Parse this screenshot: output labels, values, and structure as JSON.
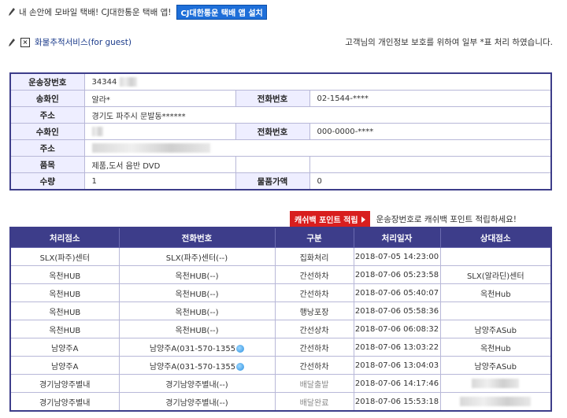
{
  "top": {
    "message": "내 손안에 모바일 택배! CJ대한통운 택배 앱!",
    "app_button": "CJ대한통운 택배 앱 설치"
  },
  "guest": {
    "title": "화물추적서비스(for guest)",
    "privacy_notice": "고객님의 개인정보 보호를 위하여 일부 *표 처리 하였습니다."
  },
  "info": {
    "waybill_label": "운송장번호",
    "waybill_value": "34344",
    "sender_label": "송화인",
    "sender_value": "알라*",
    "sender_phone_label": "전화번호",
    "sender_phone_value": "02-1544-****",
    "sender_addr_label": "주소",
    "sender_addr_value": "경기도 파주시 문발동******",
    "receiver_label": "수화인",
    "receiver_phone_label": "전화번호",
    "receiver_phone_value": "000-0000-****",
    "receiver_addr_label": "주소",
    "item_label": "품목",
    "item_value": "제품,도서 음반 DVD",
    "qty_label": "수량",
    "qty_value": "1",
    "price_label": "물품가액",
    "price_value": "0"
  },
  "cashback": {
    "button": "캐쉬백 포인트 적립",
    "text": "운송장번호로 캐쉬백 포인트 적립하세요!"
  },
  "tracking": {
    "headers": [
      "처리점소",
      "전화번호",
      "구분",
      "처리일자",
      "상대점소"
    ],
    "rows": [
      {
        "office": "SLX(파주)센터",
        "phone": "SLX(파주)센터(--)",
        "status": "집화처리",
        "date": "2018-07-05 14:23:00",
        "partner": ""
      },
      {
        "office": "옥천HUB",
        "phone": "옥천HUB(--)",
        "status": "간선하차",
        "date": "2018-07-06 05:23:58",
        "partner": "SLX(알라딘)센터"
      },
      {
        "office": "옥천HUB",
        "phone": "옥천HUB(--)",
        "status": "간선하차",
        "date": "2018-07-06 05:40:07",
        "partner": "옥천Hub"
      },
      {
        "office": "옥천HUB",
        "phone": "옥천HUB(--)",
        "status": "행낭포장",
        "date": "2018-07-06 05:58:36",
        "partner": ""
      },
      {
        "office": "옥천HUB",
        "phone": "옥천HUB(--)",
        "status": "간선상차",
        "date": "2018-07-06 06:08:32",
        "partner": "남양주ASub"
      },
      {
        "office": "남양주A",
        "phone": "남양주A(031-570-1355",
        "status": "간선하차",
        "date": "2018-07-06 13:03:22",
        "partner": "옥천Hub",
        "icon": true
      },
      {
        "office": "남양주A",
        "phone": "남양주A(031-570-1355",
        "status": "간선하차",
        "date": "2018-07-06 13:04:03",
        "partner": "남양주ASub",
        "icon": true
      },
      {
        "office": "경기남양주별내",
        "phone": "경기남양주별내(--)",
        "status": "배달출발",
        "date": "2018-07-06 14:17:46",
        "partner": "",
        "gray": true
      },
      {
        "office": "경기남양주별내",
        "phone": "경기남양주별내(--)",
        "status": "배달완료",
        "date": "2018-07-06 15:53:18",
        "partner": "",
        "gray": true
      }
    ]
  }
}
